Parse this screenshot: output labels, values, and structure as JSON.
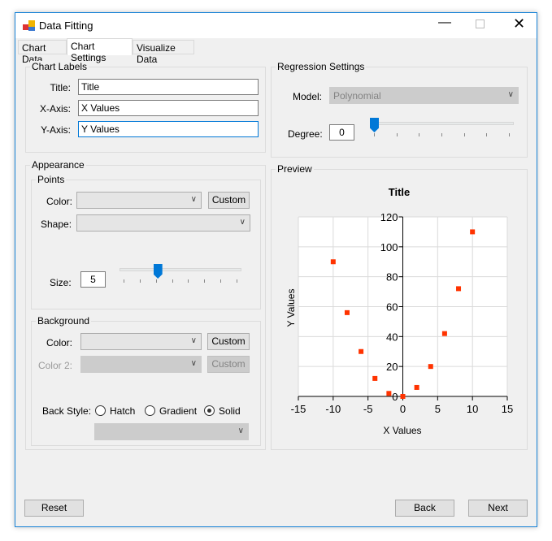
{
  "window": {
    "title": "Data Fitting",
    "app_icon": "chart-app-icon"
  },
  "tabs": [
    {
      "label": "Chart Data",
      "active": false
    },
    {
      "label": "Chart Settings",
      "active": true
    },
    {
      "label": "Visualize Data",
      "active": false
    }
  ],
  "chart_labels": {
    "legend": "Chart Labels",
    "title_label": "Title:",
    "title_value": "Title",
    "x_label": "X-Axis:",
    "x_value": "X Values",
    "y_label": "Y-Axis:",
    "y_value": "Y Values"
  },
  "appearance": {
    "legend": "Appearance",
    "points": {
      "legend": "Points",
      "color_label": "Color:",
      "color_value": "",
      "custom_label": "Custom",
      "shape_label": "Shape:",
      "shape_value": "",
      "size_label": "Size:",
      "size_value": "5",
      "size_slider_fraction": 0.3
    },
    "background": {
      "legend": "Background",
      "color_label": "Color:",
      "color_value": "",
      "custom_label": "Custom",
      "color2_label": "Color 2:",
      "color2_value": "",
      "custom2_label": "Custom",
      "back_style_label": "Back Style:",
      "options": [
        "Hatch",
        "Gradient",
        "Solid"
      ],
      "selected": "Solid",
      "style_value": ""
    }
  },
  "regression": {
    "legend": "Regression Settings",
    "model_label": "Model:",
    "model_value": "Polynomial",
    "degree_label": "Degree:",
    "degree_value": "0",
    "degree_slider_fraction": 0
  },
  "preview": {
    "legend": "Preview"
  },
  "chart_data": {
    "type": "scatter",
    "title": "Title",
    "xlabel": "X Values",
    "ylabel": "Y Values",
    "xlim": [
      -15,
      15
    ],
    "ylim": [
      0,
      120
    ],
    "xticks": [
      -15,
      -10,
      -5,
      0,
      5,
      10,
      15
    ],
    "yticks": [
      0,
      20,
      40,
      60,
      80,
      100,
      120
    ],
    "grid": true,
    "marker": "square",
    "color": "#ff3300",
    "x": [
      -10,
      -8,
      -6,
      -4,
      -2,
      0,
      2,
      4,
      6,
      8,
      10
    ],
    "y": [
      90,
      56,
      30,
      12,
      2,
      0,
      6,
      20,
      42,
      72,
      110
    ]
  },
  "buttons": {
    "reset": "Reset",
    "back": "Back",
    "next": "Next"
  }
}
